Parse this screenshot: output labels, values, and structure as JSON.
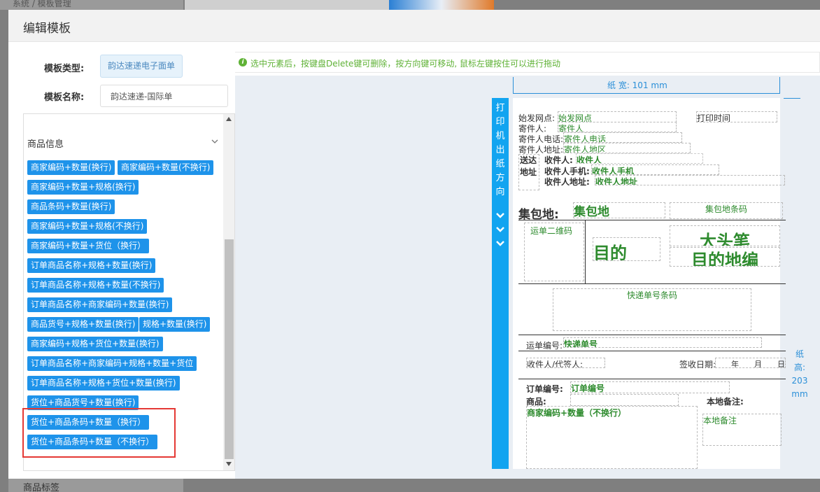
{
  "background": {
    "top_left_text": "系统 / 模板管理",
    "bottom_text": "商品标签"
  },
  "modal": {
    "title": "编辑模板"
  },
  "form": {
    "type_label": "模板类型:",
    "type_value": "韵达速递电子面单",
    "name_label": "模板名称:",
    "name_value": "韵达速递-国际单"
  },
  "left_panel": {
    "group_title": "商品信息",
    "items": [
      "商家编码+数量(换行)",
      "商家编码+数量(不换行)",
      "商家编码+数量+规格(换行)",
      "商品条码+数量(换行)",
      "商家编码+数量+规格(不换行)",
      "商家编码+数量+货位（换行）",
      "订单商品名称+规格+数量(换行)",
      "订单商品名称+规格+数量(不换行)",
      "订单商品名称+商家编码+数量(换行)",
      "商品货号+规格+数量(换行)",
      "规格+数量(换行)",
      "商家编码+规格+货位+数量(换行)",
      "订单商品名称+商家编码+规格+数量+货位",
      "订单商品名称+规格+货位+数量(换行)",
      "货位+商品货号+数量(换行)",
      "货位+商品条码+数量（换行）",
      "货位+商品条码+数量（不换行）"
    ]
  },
  "hint": {
    "icon": "i",
    "text": "选中元素后，按键盘Delete键可删除，按方向键可移动, 鼠标左键按住可以进行拖动"
  },
  "ruler": {
    "width_text": "纸 宽: 101 mm",
    "height_text": "纸 高: 203 mm"
  },
  "direction_bar": {
    "text": "打印机出纸方向"
  },
  "paper": {
    "origin_label": "始发网点:",
    "origin_value": "始发网点",
    "print_time": "打印时间",
    "sender_label": "寄件人:",
    "sender_value": "寄件人",
    "sender_phone_label": "寄件人电话:",
    "sender_phone_value": "寄件人电话",
    "sender_addr_label": "寄件人地址:",
    "sender_addr_value": "寄件人地区",
    "deliver_label_1": "送达",
    "deliver_label_2": "地址",
    "recv_label": "收件人:",
    "recv_value": "收件人",
    "recv_phone_label": "收件人手机:",
    "recv_phone_value": "收件人手机",
    "recv_addr_label": "收件人地址:",
    "recv_addr_value": "收件人地址",
    "hub_label": "集包地:",
    "hub_value": "集包地",
    "hub_barcode": "集包地条码",
    "qr_label": "运单二维码",
    "dest": "目的",
    "big_head": "大头笔",
    "dest_code": "目的地编",
    "express_barcode": "快递单号条码",
    "waybill_label": "运单编号:",
    "waybill_value": "快递单号",
    "signer_label": "收件人/代签人:",
    "sign_date_label": "签收日期:",
    "sign_date_value": "____年____月____日",
    "order_label": "订单编号:",
    "order_value": "订单编号",
    "goods_label": "商品:",
    "local_note_label": "本地备注:",
    "goods_value": "商家编码+数量（不换行）",
    "local_note_value": "本地备注"
  }
}
